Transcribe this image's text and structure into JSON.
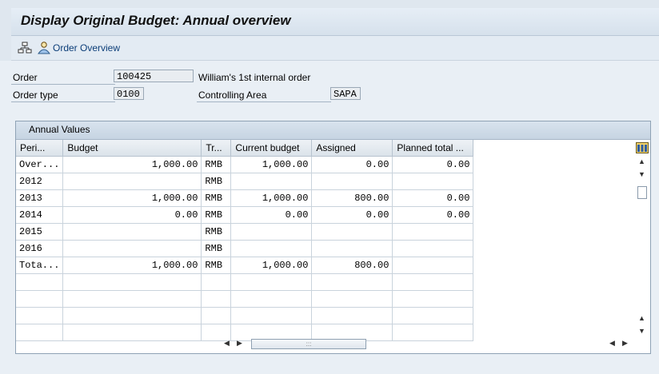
{
  "window": {
    "title": "Display Original Budget: Annual overview"
  },
  "toolbar": {
    "order_overview_label": "Order Overview"
  },
  "header": {
    "order_label": "Order",
    "order_value": "100425",
    "order_desc": "William's 1st internal order",
    "order_type_label": "Order type",
    "order_type_value": "0100",
    "controlling_area_label": "Controlling Area",
    "controlling_area_value": "SAPA"
  },
  "annual_values": {
    "title": "Annual Values",
    "columns": [
      "Peri...",
      "Budget",
      "Tr...",
      "Current budget",
      "Assigned",
      "Planned total ..."
    ],
    "rows": [
      [
        "Over...",
        "1,000.00",
        "RMB",
        "1,000.00",
        "0.00",
        "0.00"
      ],
      [
        "2012",
        "",
        "RMB",
        "",
        "",
        ""
      ],
      [
        "2013",
        "1,000.00",
        "RMB",
        "1,000.00",
        "800.00",
        "0.00"
      ],
      [
        "2014",
        "0.00",
        "RMB",
        "0.00",
        "0.00",
        "0.00"
      ],
      [
        "2015",
        "",
        "RMB",
        "",
        "",
        ""
      ],
      [
        "2016",
        "",
        "RMB",
        "",
        "",
        ""
      ],
      [
        "Tota...",
        "1,000.00",
        "RMB",
        "1,000.00",
        "800.00",
        ""
      ]
    ]
  }
}
